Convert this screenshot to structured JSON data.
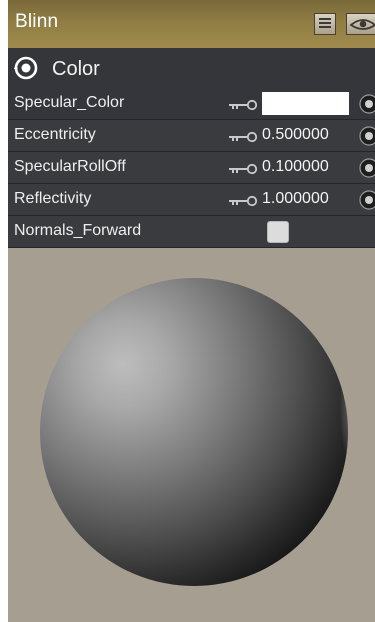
{
  "window": {
    "title": "Blinn",
    "buttons": [
      {
        "icon": "list-icon"
      },
      {
        "icon": "eye-icon"
      }
    ]
  },
  "section": {
    "icon": "collapse-toggle-icon",
    "title": "Color"
  },
  "attributes": [
    {
      "label": "Specular_Color",
      "type": "color",
      "value_color": "#ffffff",
      "key_icon": "key-icon",
      "connect_icon": "connection-icon"
    },
    {
      "label": "Eccentricity",
      "type": "number",
      "value": "0.500000",
      "key_icon": "key-icon",
      "connect_icon": "connection-icon"
    },
    {
      "label": "SpecularRollOff",
      "type": "number",
      "value": "0.100000",
      "key_icon": "key-icon",
      "connect_icon": "connection-icon"
    },
    {
      "label": "Reflectivity",
      "type": "number",
      "value": "1.000000",
      "key_icon": "key-icon",
      "connect_icon": "connection-icon"
    },
    {
      "label": "Normals_Forward",
      "type": "checkbox",
      "checked": false
    }
  ],
  "preview": {
    "type": "material-sphere",
    "background_color": "#a59e91"
  },
  "colors": {
    "titlebar": "#8f7d44",
    "panel_dark": "#3a3b3e",
    "background": "#a59e91"
  }
}
